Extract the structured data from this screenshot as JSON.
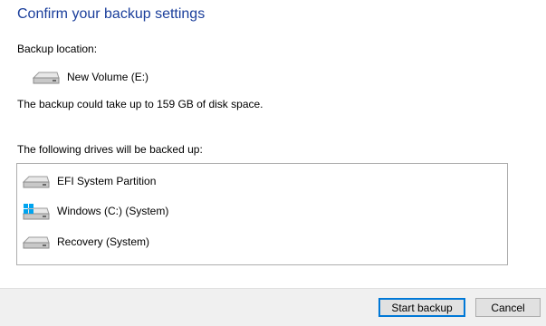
{
  "window": {
    "title": "Confirm your backup settings"
  },
  "backup_location": {
    "label": "Backup location:",
    "drive_name": "New Volume (E:)",
    "drive_icon": "hard-drive-icon"
  },
  "space_note": "The backup could take up to 159 GB of disk space.",
  "drives_section": {
    "label": "The following drives will be backed up:",
    "items": [
      {
        "name": "EFI System Partition",
        "icon": "hard-drive-icon"
      },
      {
        "name": "Windows (C:) (System)",
        "icon": "windows-drive-icon"
      },
      {
        "name": "Recovery (System)",
        "icon": "hard-drive-icon"
      }
    ]
  },
  "buttons": {
    "start_backup": "Start backup",
    "cancel": "Cancel"
  },
  "colors": {
    "title": "#1a3e9b",
    "primary_border": "#0078d7",
    "footer_bg": "#f0f0f0"
  }
}
